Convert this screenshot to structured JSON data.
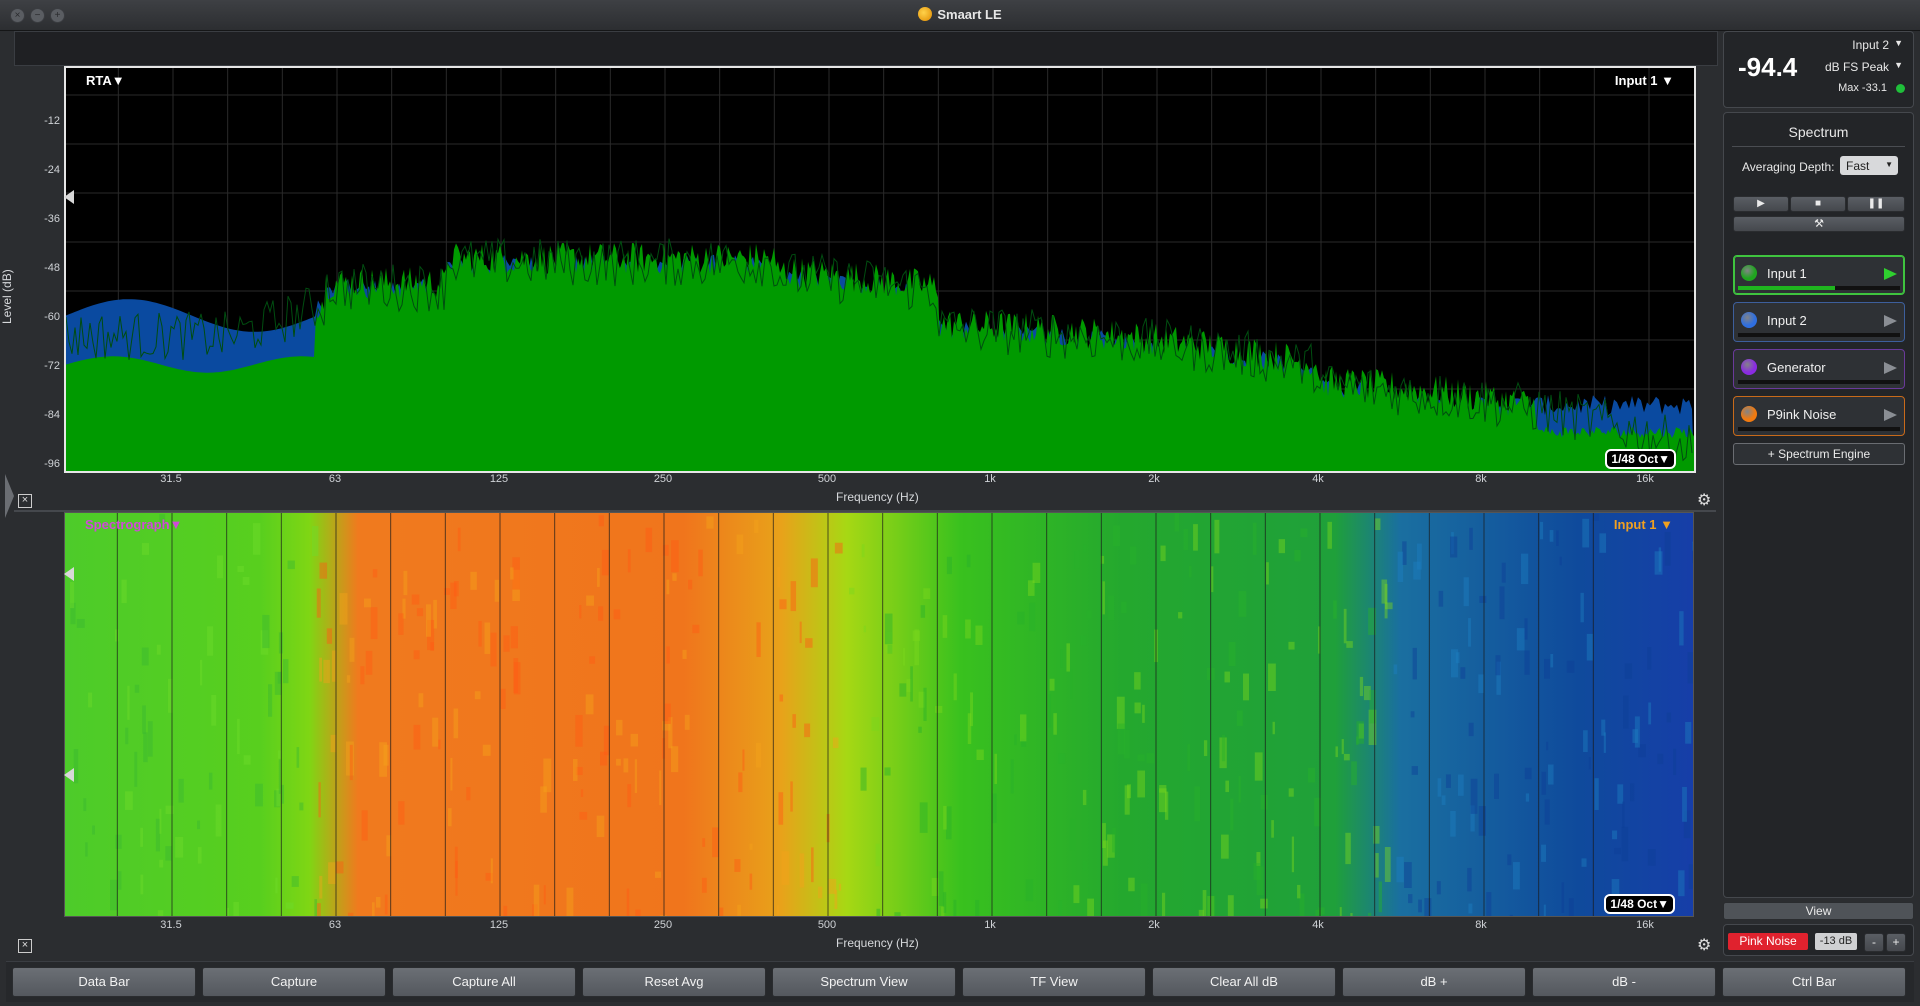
{
  "window": {
    "title": "Smaart LE"
  },
  "rta": {
    "mode_label": "RTA",
    "input_label": "Input 1",
    "resolution": "1/48 Oct",
    "y_axis_title": "Level (dB)",
    "x_axis_title": "Frequency (Hz)",
    "y_ticks": [
      "-12",
      "-24",
      "-36",
      "-48",
      "-60",
      "-72",
      "-84",
      "-96"
    ],
    "x_ticks": [
      "31.5",
      "63",
      "125",
      "250",
      "500",
      "1k",
      "2k",
      "4k",
      "8k",
      "16k"
    ],
    "colors": {
      "background": "#000000",
      "input1": "#009a00",
      "input2": "#0a4aa0",
      "grid": "#2a2a2a"
    }
  },
  "spectrograph": {
    "mode_label": "Spectrograph",
    "input_label": "Input 1",
    "resolution": "1/48 Oct",
    "x_axis_title": "Frequency (Hz)",
    "x_ticks": [
      "31.5",
      "63",
      "125",
      "250",
      "500",
      "1k",
      "2k",
      "4k",
      "8k",
      "16k"
    ]
  },
  "meter": {
    "value": "-94.4",
    "input": "Input 2",
    "units": "dB FS Peak",
    "max": "Max -33.1"
  },
  "spectrum_panel": {
    "title": "Spectrum",
    "averaging_label": "Averaging Depth:",
    "averaging_value": "Fast",
    "sources": [
      {
        "name": "Input 1",
        "color": "#1fa51f",
        "border": "#3fc43f",
        "active": true
      },
      {
        "name": "Input 2",
        "color": "#2f6fe0",
        "border": "#3d5f9c",
        "active": false
      },
      {
        "name": "Generator",
        "color": "#8a2be2",
        "border": "#6a3a9a",
        "active": false
      },
      {
        "name": "P9ink Noise",
        "color": "#f07a10",
        "border": "#c86a1a",
        "active": false
      }
    ],
    "add_engine": "+ Spectrum Engine"
  },
  "generator": {
    "view_label": "View",
    "pink_noise_label": "Pink Noise",
    "level": "-13 dB",
    "minus": "-",
    "plus": "+"
  },
  "bottom_bar": [
    "Data Bar",
    "Capture",
    "Capture All",
    "Reset Avg",
    "Spectrum View",
    "TF View",
    "Clear All dB",
    "dB +",
    "dB -",
    "Ctrl Bar"
  ]
}
